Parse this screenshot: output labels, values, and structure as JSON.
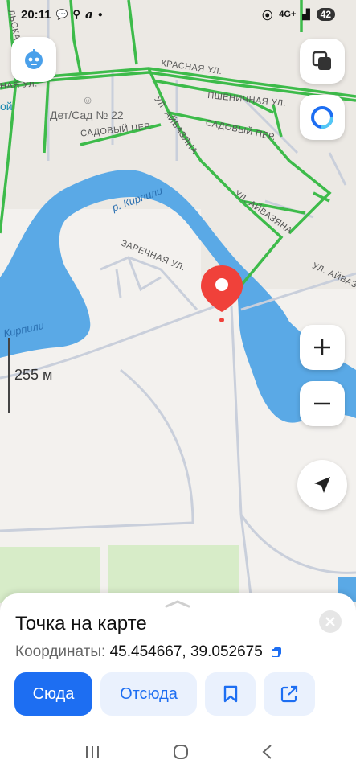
{
  "status_bar": {
    "time": "20:11",
    "network": "4G+",
    "battery": "42"
  },
  "map": {
    "street_labels": {
      "krasnaya": "КРАСНАЯ УЛ.",
      "pshenichnaya": "ПШЕНИЧНАЯ УЛ.",
      "sadovy_left": "САДОВЫЙ ПЕР.",
      "sadovy_right": "САДОВЫЙ ПЕР.",
      "ayvazyana_1": "УЛ. АЙВАЗЯНА",
      "ayvazyana_2": "УЛ. АЙВАЗЯНА",
      "ayvazyana_3": "УЛ. АЙВАЗЯНА",
      "zarechnaya": "ЗАРЕЧНАЯ УЛ.",
      "left_street": "ЛЬСКАЯ УЛ.",
      "left_cut": "НАЯ УЛ."
    },
    "poi": {
      "kindergarten": "Дет/Сад № 22",
      "left_cut": "ой"
    },
    "river_labels": {
      "top": "р. Кирпили",
      "left": "Кирпили"
    },
    "scale_label": "255 м"
  },
  "sheet": {
    "title": "Точка на карте",
    "coords_label": "Координаты:",
    "coords_value": "45.454667, 39.052675",
    "buttons": {
      "here": "Сюда",
      "from_here": "Отсюда"
    }
  },
  "colors": {
    "accent": "#1d6ef2",
    "water": "#5aa9e6",
    "road_green": "#3dbb4a",
    "pin": "#f0413a"
  }
}
